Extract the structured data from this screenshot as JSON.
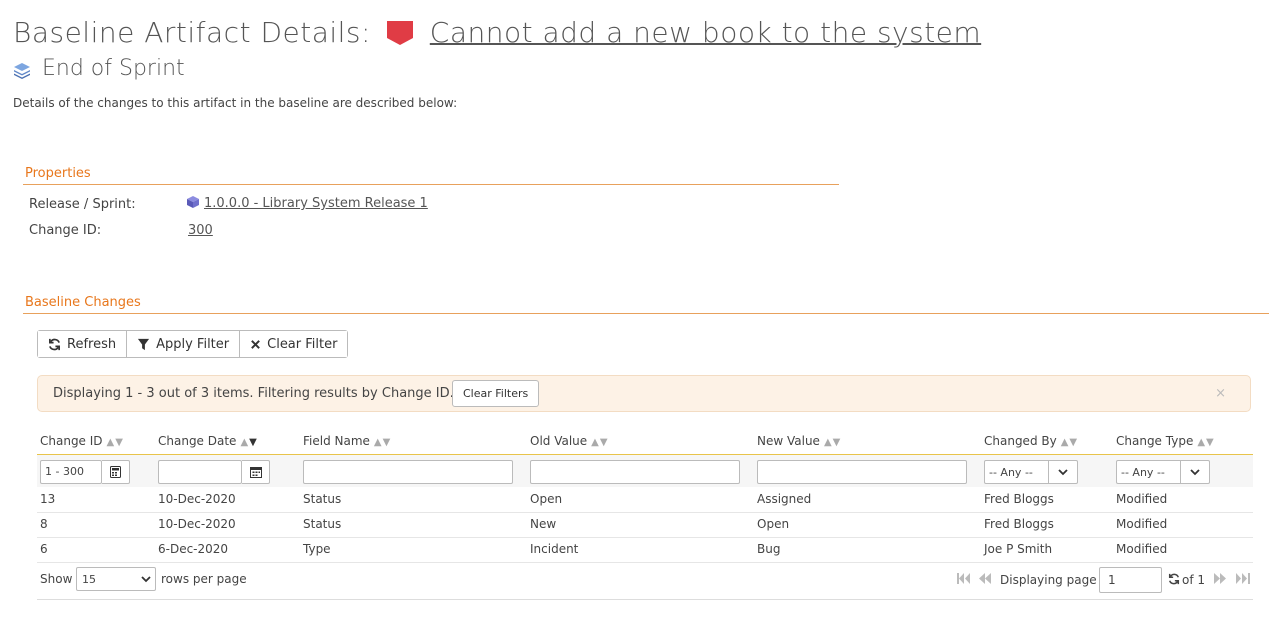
{
  "header": {
    "title_prefix": "Baseline Artifact Details:",
    "artifact_name": "Cannot add a new book to the system",
    "badge_color": "#e03c45",
    "baseline_name": "End of Sprint",
    "description": "Details of the changes to this artifact in the baseline are described below:"
  },
  "properties": {
    "section_title": "Properties",
    "release_label": "Release / Sprint:",
    "release_value": "1.0.0.0 - Library System Release 1",
    "change_id_label": "Change ID:",
    "change_id_value": "300"
  },
  "baseline_changes": {
    "section_title": "Baseline Changes",
    "toolbar": {
      "refresh": "Refresh",
      "apply_filter": "Apply Filter",
      "clear_filter": "Clear Filter"
    },
    "alert": {
      "message": "Displaying 1 - 3 out of 3 items. Filtering results by Change ID.",
      "clear_filters": "Clear Filters",
      "close": "×"
    },
    "columns": [
      "Change ID",
      "Change Date",
      "Field Name",
      "Old Value",
      "New Value",
      "Changed By",
      "Change Type"
    ],
    "filters": {
      "change_id": "1 - 300",
      "change_date": "",
      "field_name": "",
      "old_value": "",
      "new_value": "",
      "changed_by": "-- Any --",
      "change_type": "-- Any --"
    },
    "rows": [
      [
        "13",
        "10-Dec-2020",
        "Status",
        "Open",
        "Assigned",
        "Fred Bloggs",
        "Modified"
      ],
      [
        "8",
        "10-Dec-2020",
        "Status",
        "New",
        "Open",
        "Fred Bloggs",
        "Modified"
      ],
      [
        "6",
        "6-Dec-2020",
        "Type",
        "Incident",
        "Bug",
        "Joe P Smith",
        "Modified"
      ]
    ],
    "pager": {
      "show_label": "Show",
      "page_size": "15",
      "rows_per_page": "rows per page",
      "displaying_page": "Displaying page",
      "current_page": "1",
      "of_pages": "of 1"
    }
  }
}
